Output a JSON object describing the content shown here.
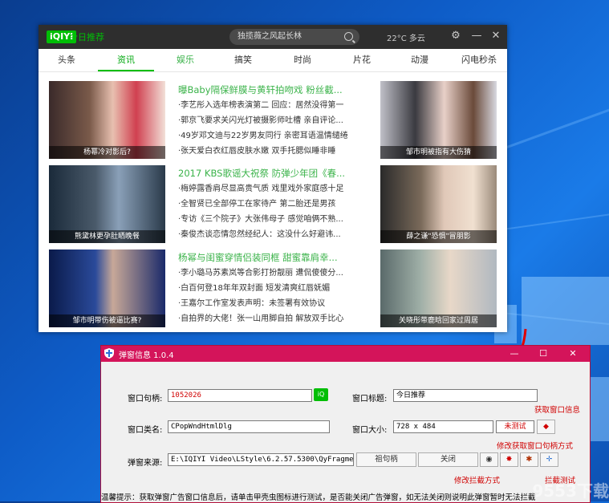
{
  "qiyi": {
    "logo_text": "iQIYI",
    "title": "今日推荐",
    "search_placeholder": "独揽薇之风起长林",
    "weather": "22°C 多云",
    "tabs": [
      "头条",
      "资讯",
      "娱乐",
      "搞笑",
      "时尚",
      "片花",
      "动漫",
      "闪电秒杀"
    ],
    "active_tab": "资讯",
    "rows": [
      {
        "left_caption": "杨幂冷对影后?",
        "headline": "曝Baby隔保鲜膜与黄轩拍吻戏 粉丝截...",
        "items": [
          "·李艺彤入选年榜表演第二 回应：居然没得第一",
          "·郭京飞要求关闪光灯被摄影师吐槽 亲自评论...",
          "·49岁邓文迪与22岁男友同行 亲密耳语温情缱绻",
          "·张天爱白衣红唇皮肤水嫩 双手托腮似睡非睡"
        ],
        "right_caption": "邹市明被指有大伤猜"
      },
      {
        "left_caption": "熊黛林更孕肚晒晚餐",
        "headline": "2017 KBS歌谣大祝祭 防弹少年团《春...",
        "items": [
          "·梅婷露香肩尽显高贵气质 戏里戏外家庭感十足",
          "·全智贤已全部停工在家待产 第二胎还是男孩",
          "·专访《三个院子》大张伟母子 感觉咱俩不熟...",
          "·秦俊杰谈恋情忽然经纪人：这没什么好避讳..."
        ],
        "right_caption": "薛之谦\"恐惧\"冒朋影"
      },
      {
        "left_caption": "邹市明带伤被逼比赛?",
        "headline": "杨幂与闺蜜穿情侣装同框 甜蜜靠肩幸...",
        "items": [
          "·李小璐马苏素岚等合影打扮靓丽 遭侃傻傻分...",
          "·白百何登18年年双封面 短发清爽红唇妩媚",
          "·王嘉尔工作室发表声明：未签署有效协议",
          "·自拍界的大佬！张一山用脚自拍 解放双手比心"
        ],
        "right_caption": "关晓彤带鹿晗回家过周居"
      }
    ]
  },
  "dialog": {
    "title": "弹窗信息 1.0.4",
    "handle_label": "窗口句柄:",
    "handle_value": "1052026",
    "title_label": "窗口标题:",
    "title_value": "今日推荐",
    "class_label": "窗口类名:",
    "class_value": "CPopWndHtmlDlg",
    "size_label": "窗口大小:",
    "size_value": "728 x 484",
    "test_value": "未测试",
    "source_label": "弹窗来源:",
    "source_value": "E:\\IQIYI Video\\LStyle\\6.2.57.5300\\QyFragment.exe",
    "btn_parent_handle": "祖句柄",
    "btn_close": "关闭",
    "note_get_info": "获取窗口信息",
    "note_modify_handle": "修改获取窗口句柄方式",
    "note_modify_block": "修改拦截方式",
    "note_block_test": "拦截测试",
    "tip": "温馨提示：获取弹窗广告窗口信息后，请单击甲壳虫图标进行测试，是否能关闭广告弹窗，如无法关闭则说明此弹窗暂时无法拦截"
  },
  "watermark": "9553下载"
}
